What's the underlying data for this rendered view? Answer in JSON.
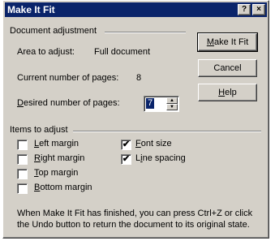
{
  "window": {
    "title": "Make It Fit",
    "help_button": "?",
    "close_button": "×"
  },
  "document_adjustment": {
    "group_label": "Document adjustment",
    "area_label": "Area to adjust:",
    "area_value": "Full document",
    "current_label": "Current number of pages:",
    "current_value": "8",
    "desired_label_prefix": "D",
    "desired_label_rest": "esired number of pages:",
    "desired_value": "7"
  },
  "buttons": {
    "make_it_fit_u": "M",
    "make_it_fit_rest": "ake It Fit",
    "cancel": "Cancel",
    "help_u": "H",
    "help_rest": "elp"
  },
  "items_to_adjust": {
    "group_label": "Items to adjust",
    "left_margin": {
      "u": "L",
      "rest": "eft margin",
      "checked": false
    },
    "right_margin": {
      "u": "R",
      "rest": "ight margin",
      "checked": false
    },
    "top_margin": {
      "u": "T",
      "rest": "op margin",
      "checked": false
    },
    "bottom_margin": {
      "u": "B",
      "rest": "ottom margin",
      "checked": false
    },
    "font_size": {
      "u": "F",
      "rest": "ont size",
      "checked": true
    },
    "line_spacing": {
      "pre": "L",
      "u": "i",
      "rest": "ne spacing",
      "checked": true
    }
  },
  "footer_text_line1": "When Make It Fit has finished, you can press Ctrl+Z or click",
  "footer_text_line2": "the Undo button to return the document to its original state.",
  "check_glyph": "✔"
}
